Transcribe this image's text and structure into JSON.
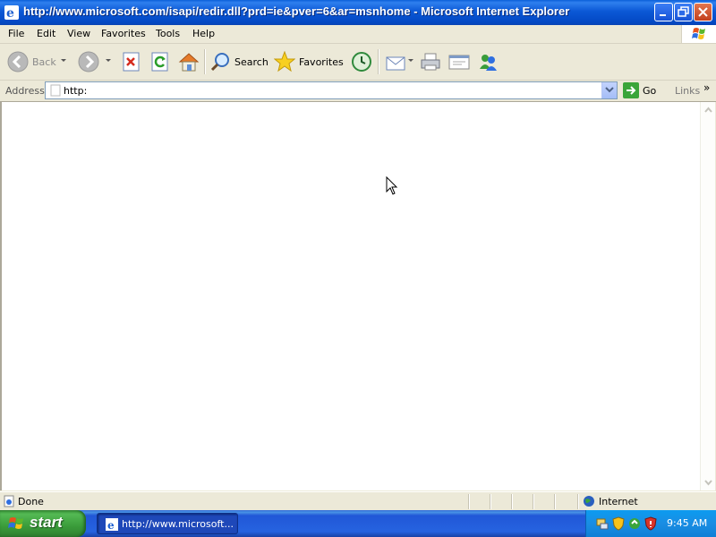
{
  "window": {
    "title": "http://www.microsoft.com/isapi/redir.dll?prd=ie&pver=6&ar=msnhome - Microsoft Internet Explorer"
  },
  "menu": [
    "File",
    "Edit",
    "View",
    "Favorites",
    "Tools",
    "Help"
  ],
  "toolbar": {
    "back_label": "Back",
    "search_label": "Search",
    "favorites_label": "Favorites"
  },
  "address_bar": {
    "label": "Address",
    "value": "http:",
    "go_label": "Go",
    "links_label": "Links",
    "links_more": "»"
  },
  "status_bar": {
    "status_text": "Done",
    "zone_text": "Internet"
  },
  "taskbar": {
    "start_label": "start",
    "task_label": "http://www.microsoft...",
    "clock": "9:45 AM"
  },
  "colors": {
    "title_bar": "#0b58d6",
    "taskbar": "#2663e0",
    "start_button": "#3a9c3a",
    "tray": "#1a8de3",
    "chrome": "#ece9d8"
  },
  "icons": [
    "ie-icon",
    "back-arrow-icon",
    "forward-arrow-icon",
    "stop-icon",
    "refresh-icon",
    "home-icon",
    "search-icon",
    "favorites-star-icon",
    "history-icon",
    "mail-icon",
    "print-icon",
    "edit-icon",
    "messenger-icon",
    "go-arrow-icon",
    "globe-icon",
    "windows-flag-icon"
  ]
}
